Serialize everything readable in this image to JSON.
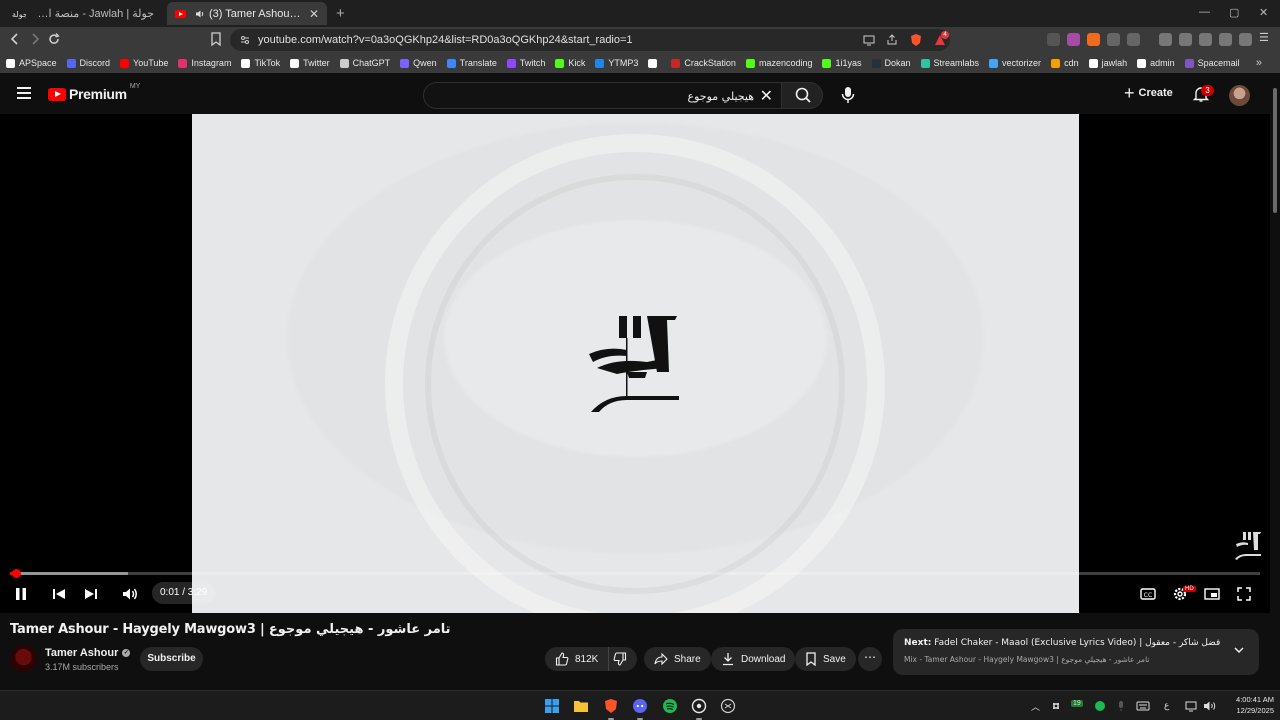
{
  "browser": {
    "tabs": [
      {
        "title": "جولة | Jawlah - منصة الألعاب التفاعلية",
        "active": false
      },
      {
        "title": "(3) Tamer Ashour - Haygely M",
        "active": true
      }
    ],
    "new_tab": "+",
    "window_controls": [
      "—",
      "▢",
      "✕"
    ],
    "url": "youtube.com/watch?v=0a3oQGKhp24&list=RD0a3oQGKhp24&start_radio=1",
    "extension_badge": "4",
    "bookmarks": [
      {
        "label": "APSpace",
        "color": "#ffffff"
      },
      {
        "label": "Discord",
        "color": "#5865f2"
      },
      {
        "label": "YouTube",
        "color": "#ff0000"
      },
      {
        "label": "Instagram",
        "color": "#e1306c"
      },
      {
        "label": "TikTok",
        "color": "#ffffff"
      },
      {
        "label": "Twitter",
        "color": "#ffffff"
      },
      {
        "label": "ChatGPT",
        "color": "#cccccc"
      },
      {
        "label": "Qwen",
        "color": "#7b61ff"
      },
      {
        "label": "Translate",
        "color": "#4285f4"
      },
      {
        "label": "Twitch",
        "color": "#9146ff"
      },
      {
        "label": "Kick",
        "color": "#53fc18"
      },
      {
        "label": "YTMP3",
        "color": "#1e88e5"
      },
      {
        "label": "",
        "color": "#ffffff"
      },
      {
        "label": "CrackStation",
        "color": "#c62828"
      },
      {
        "label": "mazencoding",
        "color": "#53fc18"
      },
      {
        "label": "1i1yas",
        "color": "#53fc18"
      },
      {
        "label": "Dokan",
        "color": "#263238"
      },
      {
        "label": "Streamlabs",
        "color": "#31c3a2"
      },
      {
        "label": "vectorizer",
        "color": "#42a5f5"
      },
      {
        "label": "cdn",
        "color": "#f4a000"
      },
      {
        "label": "jawlah",
        "color": "#ffffff"
      },
      {
        "label": "admin",
        "color": "#ffffff"
      },
      {
        "label": "Spacemail",
        "color": "#7e57c2"
      }
    ],
    "bookmarks_more": "»"
  },
  "youtube": {
    "logo_text": "Premium",
    "logo_region": "MY",
    "search_value": "هيجيلي موجوع",
    "create_label": "Create",
    "notification_count": "3"
  },
  "player": {
    "current_time": "0:01",
    "duration": "3:29",
    "time_display": "0:01 / 3:29",
    "progress_fraction": 0.005,
    "buffered_fraction": 0.094,
    "hd_badge": "HD"
  },
  "video": {
    "title": "Tamer Ashour - Haygely Mawgow3 | تامر عاشور - هيجيلي موجوع",
    "channel_name": "Tamer Ashour",
    "subscribers": "3.17M subscribers",
    "subscribe_label": "Subscribe",
    "likes": "812K",
    "share_label": "Share",
    "download_label": "Download",
    "save_label": "Save",
    "more_label": "⋯"
  },
  "up_next": {
    "label": "Next:",
    "title": "Fadel Chaker - Maaol (Exclusive Lyrics Video) | فضل شاكر - معقول",
    "subtitle": "Mix - Tamer Ashour - Haygely Mawgow3 | تامر عاشور - هيجيلي موجوع"
  },
  "taskbar": {
    "tray_badge": "19",
    "lang": "ع",
    "time": "4:00:41 AM",
    "date": "12/29/2025"
  }
}
